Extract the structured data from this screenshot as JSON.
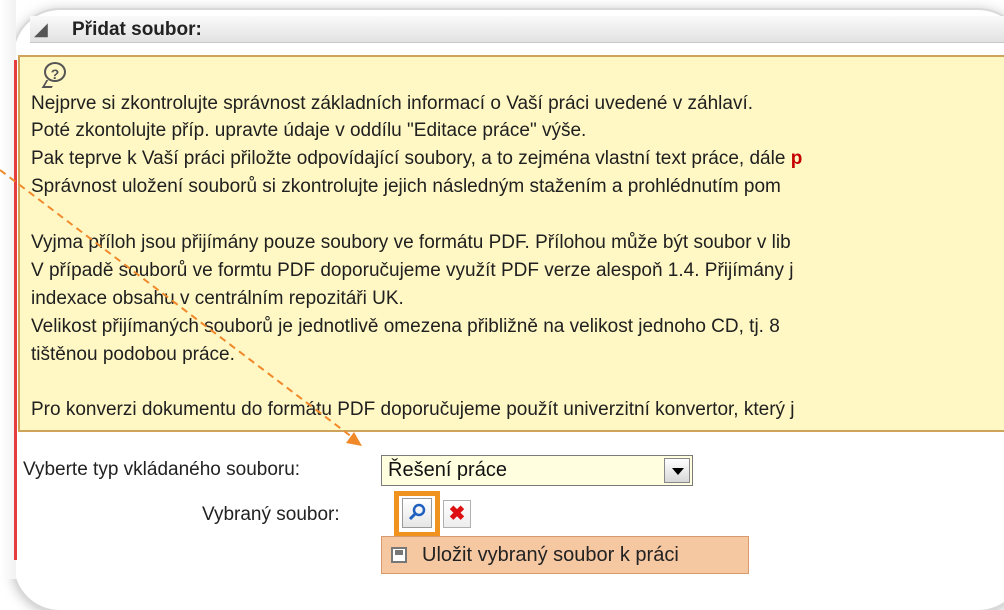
{
  "section": {
    "title": "Přidat soubor:"
  },
  "notice": {
    "lines": [
      "Nejprve si zkontrolujte správnost základních informací o Vaší práci uvedené v záhlaví.",
      "Poté zkontolujte příp. upravte údaje v oddílu \"Editace práce\" výše.",
      "Pak teprve k Vaší práci přiložte odpovídající soubory, a to zejména vlastní text práce, dále ",
      "Správnost uložení souborů si zkontrolujte jejich následným stažením a prohlédnutím pom",
      "",
      "Vyjma příloh jsou přijímány pouze soubory ve formátu PDF. Přílohou může být soubor v lib",
      "V případě souborů ve formtu PDF doporučujeme využít PDF verze alespoň 1.4. Přijímány j",
      "indexace obsahu v centrálním repozitáři UK.",
      "Velikost přijímaných souborů je jednotlivě omezena přibližně na velikost jednoho CD, tj. 8",
      "tištěnou podobou práce.",
      "",
      "Pro konverzi dokumentu do formátu PDF doporučujeme použít univerzitní konvertor, který j"
    ],
    "line3_cut": "p"
  },
  "form": {
    "file_type_label": "Vyberte typ vkládaného souboru:",
    "file_type_value": "Řešení práce",
    "selected_file_label": "Vybraný soubor:",
    "save_button_label": "Uložit vybraný soubor k práci"
  },
  "icons": {
    "help": "help-icon",
    "browse": "magnifier-icon",
    "clear": "close-icon",
    "save": "save-icon",
    "dropdown": "chevron-down-icon"
  },
  "colors": {
    "notice_bg": "#fff8c4",
    "highlight": "#f0921e",
    "save_button_bg": "#f6c8a2"
  }
}
